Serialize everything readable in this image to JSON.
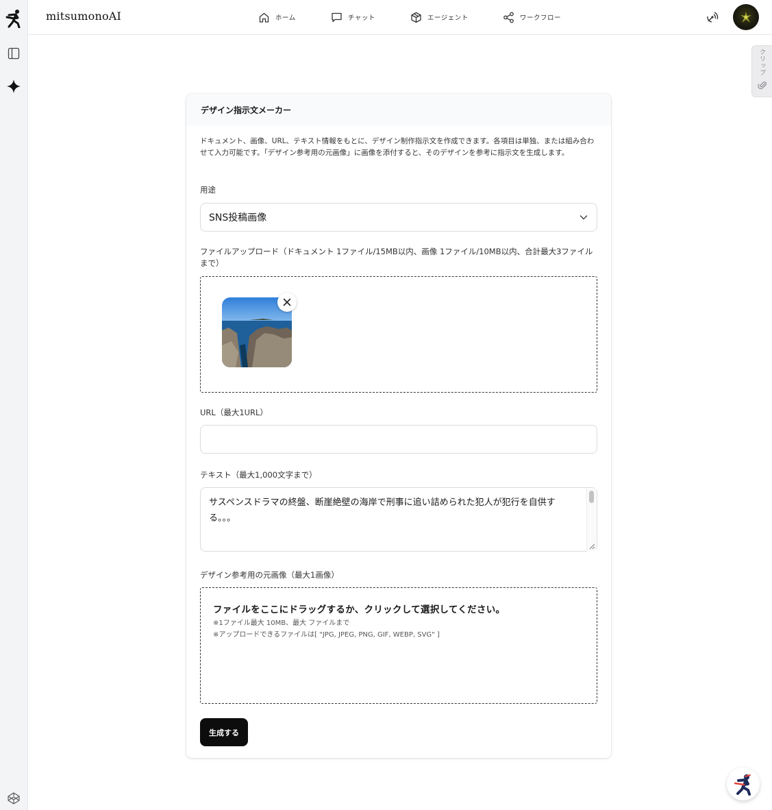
{
  "app": {
    "brand": "mitsumonoAI"
  },
  "nav": {
    "home": "ホーム",
    "chat": "チャット",
    "agent": "エージェント",
    "workflow": "ワークフロー"
  },
  "clip_tab": {
    "label": "クリップ"
  },
  "form": {
    "title": "デザイン指示文メーカー",
    "description": "ドキュメント、画像、URL、テキスト情報をもとに、デザイン制作指示文を作成できます。各項目は単独、または組み合わせて入力可能です。「デザイン参考用の元画像」に画像を添付すると、そのデザインを参考に指示文を生成します。",
    "purpose_label": "用途",
    "purpose_value": "SNS投稿画像",
    "upload_label": "ファイルアップロード（ドキュメント 1ファイル/15MB以内、画像 1ファイル/10MB以内、合計最大3ファイルまで）",
    "url_label": "URL（最大1URL）",
    "url_value": "",
    "text_label": "テキスト（最大1,000文字まで）",
    "text_value": "サスペンスドラマの終盤、断崖絶壁の海岸で刑事に追い詰められた犯人が犯行を自供する。。。",
    "ref_label": "デザイン参考用の元画像（最大1画像）",
    "ref_drop_title": "ファイルをここにドラッグするか、クリックして選択してください。",
    "ref_note_1": "※1ファイル最大 10MB、最大 ファイルまで",
    "ref_note_2": "※アップロードできるファイルは[ \"JPG, JPEG, PNG, GIF, WEBP, SVG\" ]",
    "submit_label": "生成する"
  },
  "colors": {
    "accent": "#0d0d0d",
    "rail_bg": "#f3f4f6",
    "card_head_bg": "#f8fafc"
  },
  "icons": {
    "rail": [
      "runner-logo-icon",
      "sidebar-toggle-icon",
      "sparkle-icon",
      "codepen-icon"
    ],
    "nav": [
      "home-icon",
      "chat-icon",
      "cube-icon",
      "share-icon"
    ],
    "header_right": [
      "broadcast-icon",
      "avatar"
    ]
  }
}
